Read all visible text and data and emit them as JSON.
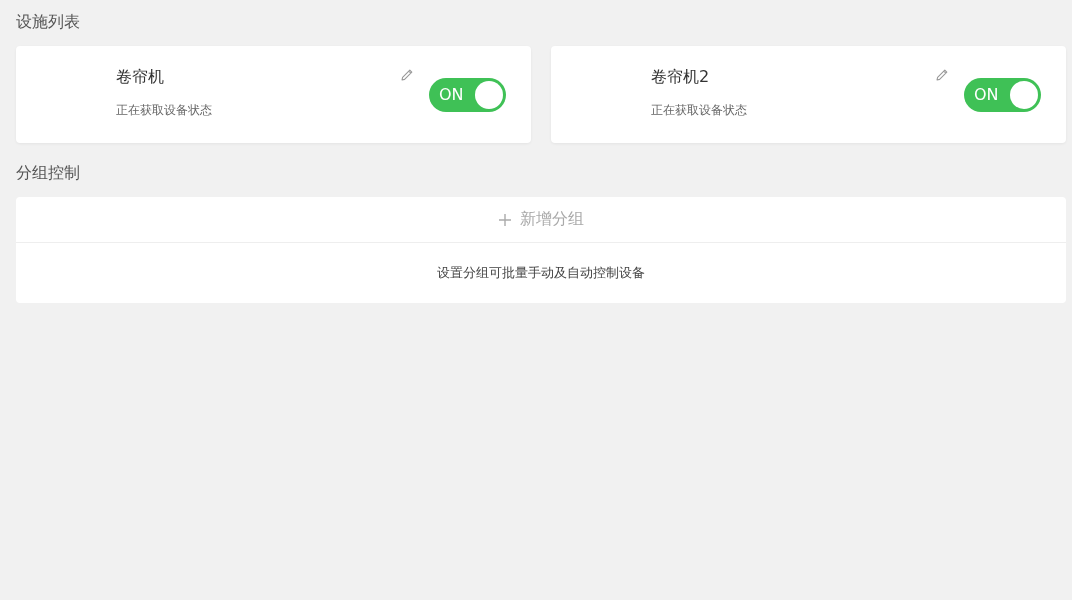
{
  "facilities": {
    "title": "设施列表",
    "devices": [
      {
        "name": "卷帘机",
        "status": "正在获取设备状态",
        "toggle": {
          "label": "ON",
          "on": true
        }
      },
      {
        "name": "卷帘机2",
        "status": "正在获取设备状态",
        "toggle": {
          "label": "ON",
          "on": true
        }
      }
    ]
  },
  "groups": {
    "title": "分组控制",
    "add_label": "新增分组",
    "hint": "设置分组可批量手动及自动控制设备"
  }
}
